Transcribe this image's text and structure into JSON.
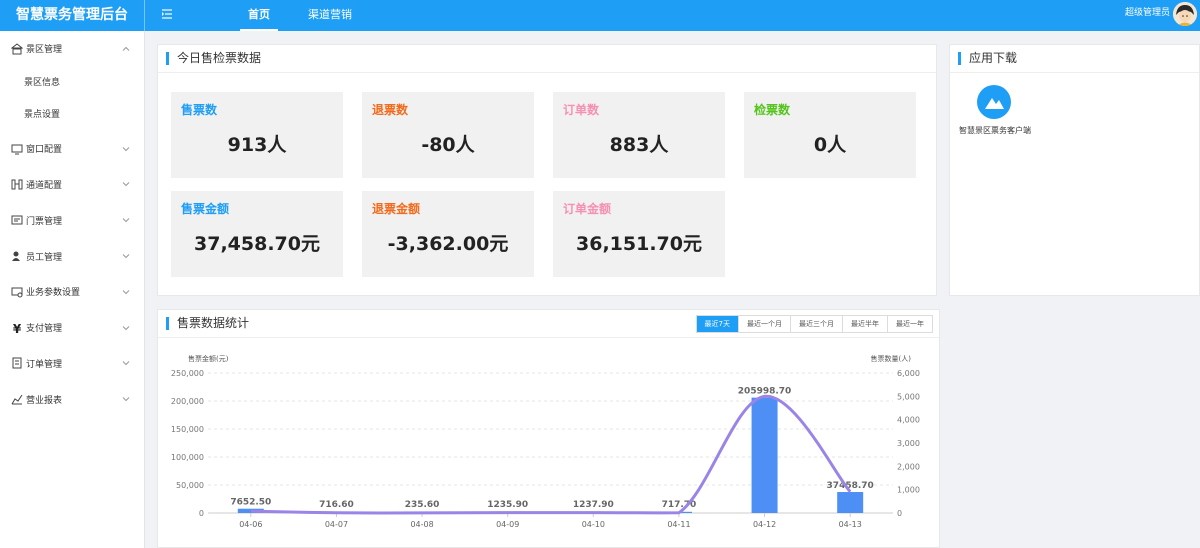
{
  "app": {
    "title": "智慧票务管理后台"
  },
  "topnav": {
    "items": [
      "首页",
      "渠道营销"
    ],
    "active": 0
  },
  "user": {
    "name": "超级管理员"
  },
  "sidebar": {
    "items": [
      {
        "label": "景区管理",
        "icon": "scenic-icon",
        "expanded": true,
        "children": [
          "景区信息",
          "景点设置"
        ]
      },
      {
        "label": "窗口配置",
        "icon": "monitor-icon"
      },
      {
        "label": "通道配置",
        "icon": "gate-icon"
      },
      {
        "label": "门票管理",
        "icon": "ticket-icon"
      },
      {
        "label": "员工管理",
        "icon": "staff-icon"
      },
      {
        "label": "业务参数设置",
        "icon": "settings-icon"
      },
      {
        "label": "支付管理",
        "icon": "yuan-icon"
      },
      {
        "label": "订单管理",
        "icon": "order-icon"
      },
      {
        "label": "营业报表",
        "icon": "report-icon"
      }
    ]
  },
  "today": {
    "title": "今日售检票数据",
    "cards": [
      {
        "label": "售票数",
        "value": "913人",
        "color": "#1e9ef5"
      },
      {
        "label": "退票数",
        "value": "-80人",
        "color": "#f26b1d"
      },
      {
        "label": "订单数",
        "value": "883人",
        "color": "#f78fb3"
      },
      {
        "label": "检票数",
        "value": "0人",
        "color": "#52c41a"
      },
      {
        "label": "售票金额",
        "value": "37,458.70元",
        "color": "#1e9ef5"
      },
      {
        "label": "退票金额",
        "value": "-3,362.00元",
        "color": "#f26b1d"
      },
      {
        "label": "订单金额",
        "value": "36,151.70元",
        "color": "#f78fb3"
      }
    ]
  },
  "apps": {
    "title": "应用下载",
    "items": [
      {
        "name": "智慧景区票务客户端",
        "icon": "mountain-icon"
      }
    ]
  },
  "stats": {
    "title": "售票数据统计",
    "ranges": [
      "最近7天",
      "最近一个月",
      "最近三个月",
      "最近半年",
      "最近一年"
    ],
    "active_range": 0
  },
  "chart_data": {
    "type": "bar",
    "categories": [
      "04-06",
      "04-07",
      "04-08",
      "04-09",
      "04-10",
      "04-11",
      "04-12",
      "04-13"
    ],
    "series": [
      {
        "type": "bar",
        "axis": "left",
        "values": [
          7652.5,
          716.6,
          235.6,
          1235.9,
          1237.9,
          717.7,
          205998.7,
          37458.7
        ],
        "labels": [
          "7652.50",
          "716.60",
          "235.60",
          "1235.90",
          "1237.90",
          "717.70",
          "205998.70",
          "37458.70"
        ],
        "color": "#4d8ff5"
      },
      {
        "type": "line",
        "axis": "right",
        "smooth": true,
        "values": [
          80,
          10,
          3,
          15,
          15,
          10,
          5000,
          913
        ],
        "color": "#9a84e8"
      }
    ],
    "ylabel": "售票金额(元)",
    "y2label": "售票数量(人)",
    "ylim": [
      0,
      250000
    ],
    "y2lim": [
      0,
      6000
    ],
    "yticks": [
      "0",
      "50,000",
      "100,000",
      "150,000",
      "200,000",
      "250,000"
    ],
    "y2ticks": [
      "0",
      "1,000",
      "2,000",
      "3,000",
      "4,000",
      "5,000",
      "6,000"
    ],
    "grid": true
  }
}
